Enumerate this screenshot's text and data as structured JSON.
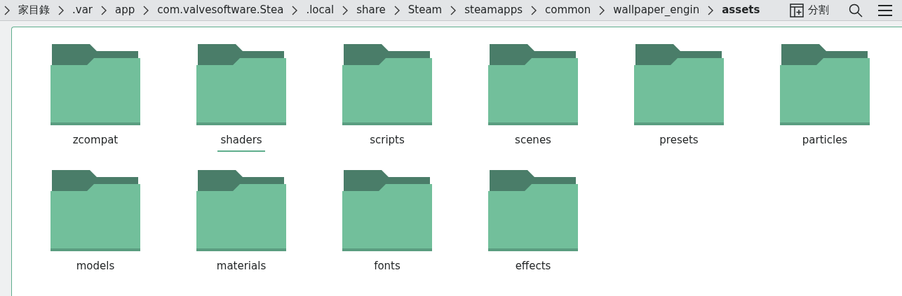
{
  "breadcrumb": [
    {
      "label": "家目錄",
      "current": false
    },
    {
      "label": ".var",
      "current": false
    },
    {
      "label": "app",
      "current": false
    },
    {
      "label": "com.valvesoftware.Stea",
      "current": false
    },
    {
      "label": ".local",
      "current": false
    },
    {
      "label": "share",
      "current": false
    },
    {
      "label": "Steam",
      "current": false
    },
    {
      "label": "steamapps",
      "current": false
    },
    {
      "label": "common",
      "current": false
    },
    {
      "label": "wallpaper_engin",
      "current": false
    },
    {
      "label": "assets",
      "current": true
    }
  ],
  "toolbar": {
    "split_label": "分割"
  },
  "folders": [
    {
      "name": "zcompat",
      "focused": false
    },
    {
      "name": "shaders",
      "focused": true
    },
    {
      "name": "scripts",
      "focused": false
    },
    {
      "name": "scenes",
      "focused": false
    },
    {
      "name": "presets",
      "focused": false
    },
    {
      "name": "particles",
      "focused": false
    },
    {
      "name": "models",
      "focused": false
    },
    {
      "name": "materials",
      "focused": false
    },
    {
      "name": "fonts",
      "focused": false
    },
    {
      "name": "effects",
      "focused": false
    }
  ]
}
